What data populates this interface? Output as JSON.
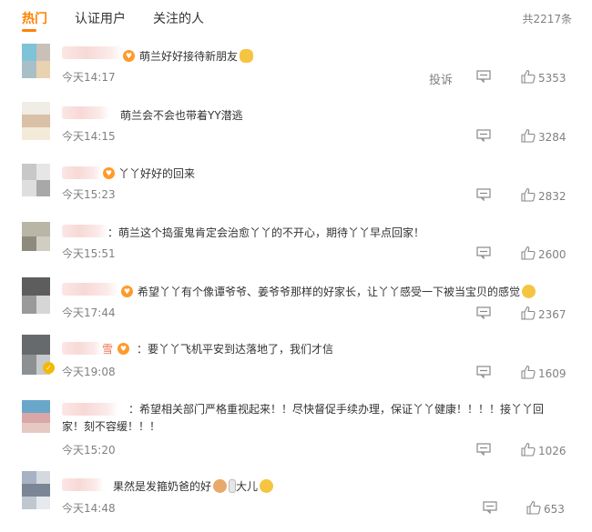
{
  "tabs": [
    {
      "label": "热门",
      "active": true
    },
    {
      "label": "认证用户",
      "active": false
    },
    {
      "label": "关注的人",
      "active": false
    }
  ],
  "total_count": "共2217条",
  "report_label": "投诉",
  "colors": {
    "accent": "#ff8200",
    "text": "#333333",
    "muted": "#808080"
  },
  "comments": [
    {
      "text": "萌兰好好接待新朋友",
      "time": "今天14:17",
      "likes": "5353",
      "emoji": "hug-emoji"
    },
    {
      "text": "萌兰会不会也带着YY潜逃",
      "time": "今天14:15",
      "likes": "3284"
    },
    {
      "text": "丫丫好好的回来",
      "time": "今天15:23",
      "likes": "2832"
    },
    {
      "text": "：萌兰这个捣蛋鬼肯定会治愈丫丫的不开心，期待丫丫早点回家！",
      "time": "今天15:51",
      "likes": "2600"
    },
    {
      "text": "希望丫丫有个像谭爷爷、姜爷爷那样的好家长，让丫丫感受一下被当宝贝的感觉",
      "time": "今天17:44",
      "likes": "2367",
      "emoji": "crying-emoji"
    },
    {
      "prefix": "雪",
      "text": "要丫丫飞机平安到达落地了，我们才信",
      "time": "今天19:08",
      "likes": "1609"
    },
    {
      "text": "：希望相关部门严格重视起来！！尽快督促手续办理，保证丫丫健康！！！！接丫丫回家！刻不容缓！！！",
      "time": "今天15:20",
      "likes": "1026"
    },
    {
      "text": "果然是发箍奶爸的好",
      "suffix": "大儿",
      "time": "今天14:48",
      "likes": "653",
      "emoji": "laughing-emoji"
    }
  ]
}
